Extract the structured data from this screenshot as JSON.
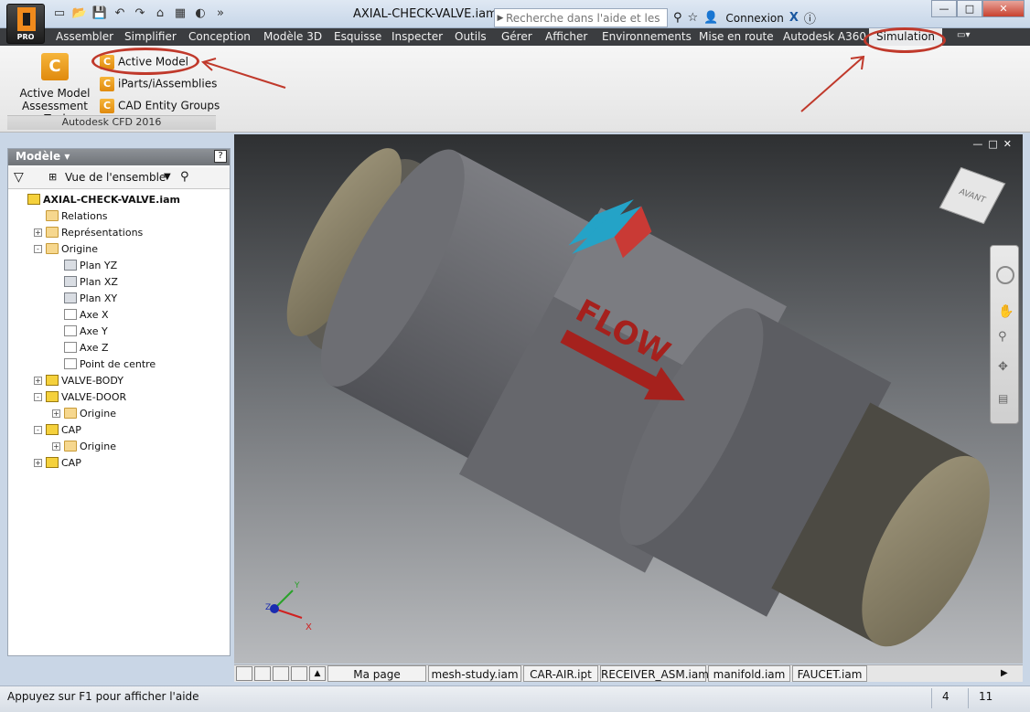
{
  "app": {
    "badge": "PRO"
  },
  "window": {
    "title": "AXIAL-CHECK-VALVE.iam",
    "search_placeholder": "Recherche dans l'aide et les com",
    "sign_in": "Connexion"
  },
  "ribbon": {
    "tabs": [
      "Assembler",
      "Simplifier",
      "Conception",
      "Modèle 3D",
      "Esquisse",
      "Inspecter",
      "Outils",
      "Gérer",
      "Afficher",
      "Environnements",
      "Mise en route",
      "Autodesk A360",
      "Simulation"
    ],
    "active_tab": "Simulation",
    "panel": {
      "big_tool": "Active Model Assessment Tool",
      "small_tools": [
        "Active Model",
        "iParts/iAssemblies",
        "CAD Entity Groups"
      ],
      "title": "Autodesk CFD 2016"
    }
  },
  "browser": {
    "title": "Modèle",
    "view_mode": "Vue de l'ensemble",
    "tree": [
      {
        "label": "AXIAL-CHECK-VALVE.iam",
        "level": 0,
        "icon": "assembly-icon",
        "expander": "",
        "bold": true
      },
      {
        "label": "Relations",
        "level": 1,
        "icon": "folder-icon",
        "expander": ""
      },
      {
        "label": "Représentations",
        "level": 1,
        "icon": "representations-icon",
        "expander": "+"
      },
      {
        "label": "Origine",
        "level": 1,
        "icon": "folder-open-icon",
        "expander": "-"
      },
      {
        "label": "Plan YZ",
        "level": 2,
        "icon": "plane-icon",
        "expander": ""
      },
      {
        "label": "Plan XZ",
        "level": 2,
        "icon": "plane-icon",
        "expander": ""
      },
      {
        "label": "Plan XY",
        "level": 2,
        "icon": "plane-icon",
        "expander": ""
      },
      {
        "label": "Axe X",
        "level": 2,
        "icon": "axis-icon",
        "expander": ""
      },
      {
        "label": "Axe Y",
        "level": 2,
        "icon": "axis-icon",
        "expander": ""
      },
      {
        "label": "Axe Z",
        "level": 2,
        "icon": "axis-icon",
        "expander": ""
      },
      {
        "label": "Point de centre",
        "level": 2,
        "icon": "point-icon",
        "expander": ""
      },
      {
        "label": "VALVE-BODY",
        "level": 1,
        "icon": "part-icon",
        "expander": "+"
      },
      {
        "label": "VALVE-DOOR",
        "level": 1,
        "icon": "part-icon",
        "expander": "-"
      },
      {
        "label": "Origine",
        "level": 2,
        "icon": "folder-icon",
        "expander": "+"
      },
      {
        "label": "CAP",
        "level": 1,
        "icon": "part-icon",
        "expander": "-"
      },
      {
        "label": "Origine",
        "level": 2,
        "icon": "folder-icon",
        "expander": "+"
      },
      {
        "label": "CAP",
        "level": 1,
        "icon": "part-icon",
        "expander": "+"
      }
    ]
  },
  "viewport": {
    "viewcube_text": "AVANT",
    "model_text": "FLOW",
    "axes": [
      "X",
      "Y",
      "Z"
    ],
    "colors": {
      "body": "#6e6f74",
      "caps": "#8a8066",
      "arrow": "#a5211d"
    }
  },
  "doc_tabs": [
    "Ma page d'accueil",
    "mesh-study.iam",
    "CAR-AIR.ipt",
    "RECEIVER_ASM.iam",
    "manifold.iam",
    "FAUCET.iam"
  ],
  "status": {
    "message": "Appuyez sur F1 pour afficher l'aide",
    "count1": "4",
    "count2": "11"
  }
}
